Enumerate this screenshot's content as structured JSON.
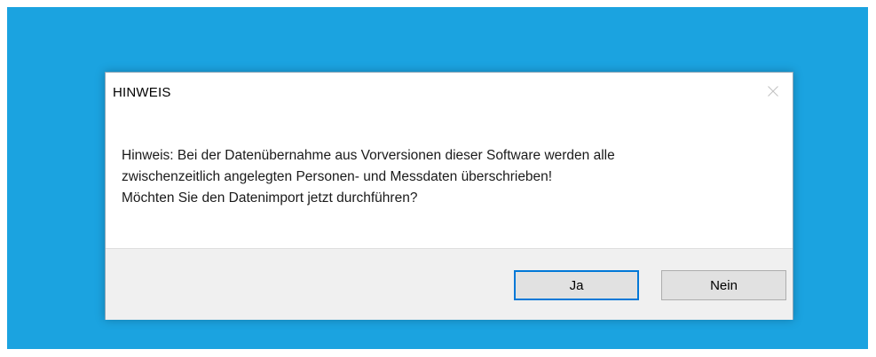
{
  "dialog": {
    "title": "HINWEIS",
    "close_icon": "close-icon",
    "message_lines": [
      "Hinweis: Bei der Datenübernahme aus Vorversionen dieser Software werden alle",
      "zwischenzeitlich angelegten Personen- und Messdaten überschrieben!",
      "Möchten Sie den Datenimport jetzt durchführen?"
    ],
    "buttons": {
      "yes_label": "Ja",
      "no_label": "Nein"
    }
  },
  "colors": {
    "desktop_background": "#1ba3e0",
    "dialog_background": "#ffffff",
    "footer_background": "#f0f0f0",
    "button_face": "#e1e1e1",
    "focus_border": "#0078d7"
  }
}
